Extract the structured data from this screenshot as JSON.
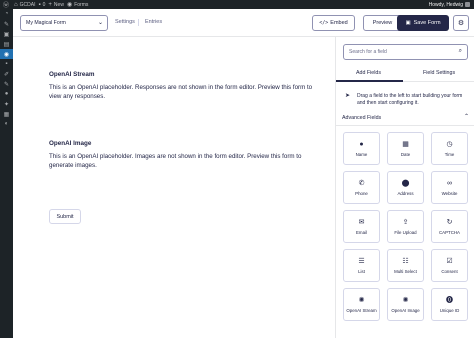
{
  "adminbar": {
    "wp_icon": "wordpress-icon",
    "site_name": "GCDAI",
    "comments_count": "0",
    "new_label": "New",
    "forms_label": "Forms",
    "howdy": "Howdy, Hedwig"
  },
  "wpmenu": {
    "items": [
      {
        "icon": "dashboard-icon",
        "glyph": "◔"
      },
      {
        "icon": "pin-icon",
        "glyph": "✎"
      },
      {
        "icon": "media-icon",
        "glyph": "▣"
      },
      {
        "icon": "comments-icon",
        "glyph": "▤"
      },
      {
        "icon": "forms-icon",
        "glyph": "◉",
        "active": true
      },
      {
        "icon": "comment-icon",
        "glyph": "▪"
      },
      {
        "icon": "appearance-icon",
        "glyph": "✐"
      },
      {
        "icon": "plugins-icon",
        "glyph": "✎"
      },
      {
        "icon": "users-icon",
        "glyph": "●"
      },
      {
        "icon": "tools-icon",
        "glyph": "✦"
      },
      {
        "icon": "settings-icon",
        "glyph": "▦"
      },
      {
        "icon": "collapse-icon",
        "glyph": "◐"
      }
    ]
  },
  "toolbar": {
    "form_name": "My Magical Form",
    "settings_label": "Settings",
    "entries_label": "Entries",
    "embed_label": "Embed",
    "preview_label": "Preview",
    "save_label": "Save Form"
  },
  "canvas": {
    "fields": [
      {
        "title": "OpenAI Stream",
        "description": "This is an OpenAI placeholder. Responses are not shown in the form editor. Preview this form to view any responses."
      },
      {
        "title": "OpenAI Image",
        "description": "This is an OpenAI placeholder. Images are not shown in the form editor. Preview this form to generate images."
      }
    ],
    "submit_label": "Submit"
  },
  "panel": {
    "search_placeholder": "Search for a field",
    "tabs": [
      {
        "label": "Add Fields",
        "active": true
      },
      {
        "label": "Field Settings",
        "active": false
      }
    ],
    "hint": "Drag a field to the left to start building your form and then start configuring it.",
    "section_title": "Advanced Fields",
    "fields": [
      {
        "label": "Name",
        "icon": "person-icon",
        "glyph": "●"
      },
      {
        "label": "Date",
        "icon": "calendar-icon",
        "glyph": "▦"
      },
      {
        "label": "Time",
        "icon": "clock-icon",
        "glyph": "◷"
      },
      {
        "label": "Phone",
        "icon": "phone-icon",
        "glyph": "✆"
      },
      {
        "label": "Address",
        "icon": "map-pin-icon",
        "glyph": "⬤"
      },
      {
        "label": "Website",
        "icon": "link-icon",
        "glyph": "∞"
      },
      {
        "label": "Email",
        "icon": "envelope-icon",
        "glyph": "✉"
      },
      {
        "label": "File Upload",
        "icon": "upload-icon",
        "glyph": "⇪"
      },
      {
        "label": "CAPTCHA",
        "icon": "captcha-icon",
        "glyph": "↻"
      },
      {
        "label": "List",
        "icon": "list-icon",
        "glyph": "☰"
      },
      {
        "label": "Multi Select",
        "icon": "multi-select-icon",
        "glyph": "☷"
      },
      {
        "label": "Consent",
        "icon": "consent-icon",
        "glyph": "☑"
      },
      {
        "label": "OpenAI Stream",
        "icon": "openai-icon",
        "glyph": "✺"
      },
      {
        "label": "OpenAI Image",
        "icon": "openai-icon",
        "glyph": "✺"
      },
      {
        "label": "Unique ID",
        "icon": "id-icon",
        "glyph": "⓿"
      }
    ]
  },
  "colors": {
    "accent": "#242748",
    "wp_dark": "#1d2327",
    "wp_active": "#2271b1"
  }
}
